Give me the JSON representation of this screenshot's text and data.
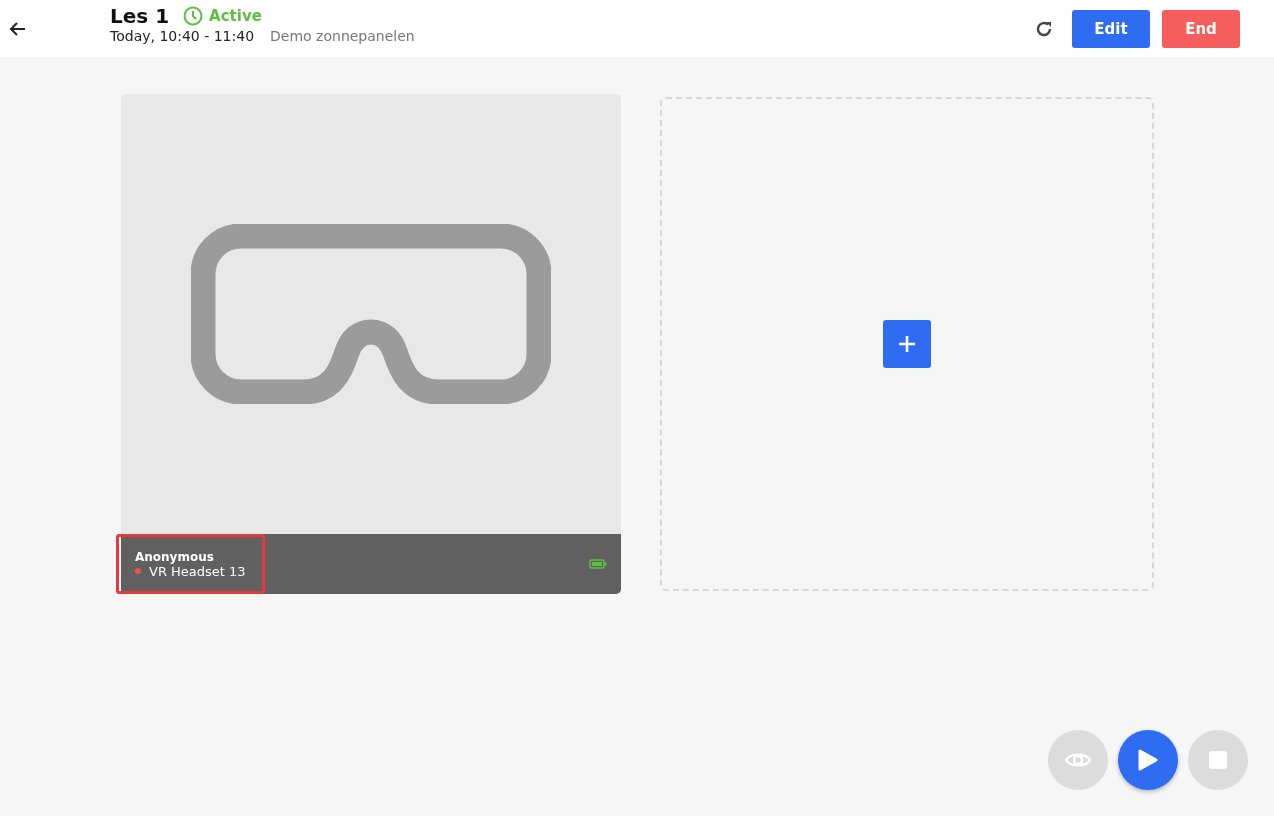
{
  "header": {
    "title": "Les 1",
    "status": "Active",
    "time": "Today, 10:40 -  11:40",
    "subtitle": "Demo zonnepanelen",
    "buttons": [
      {
        "label": "Edit",
        "kind": "primary"
      },
      {
        "label": "End",
        "kind": "danger"
      }
    ]
  },
  "headsets": [
    {
      "user": "Anonymous",
      "device": "VR Headset 13",
      "color": "#f0524f",
      "selected": true
    }
  ],
  "controls": [
    {
      "kind": "eye",
      "disabled": true
    },
    {
      "kind": "play",
      "disabled": false
    },
    {
      "kind": "stop",
      "disabled": true
    }
  ]
}
